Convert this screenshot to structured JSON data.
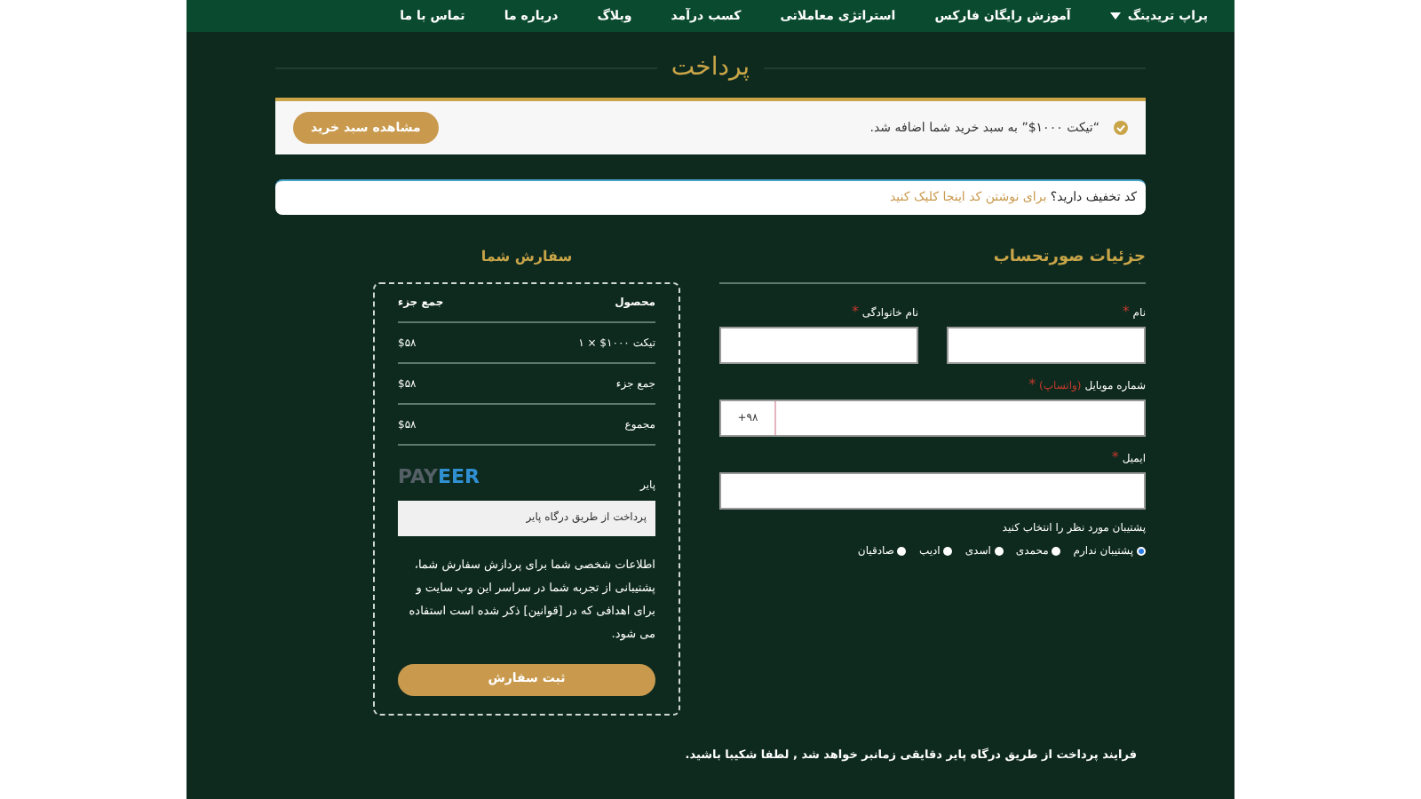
{
  "nav": [
    {
      "label": "پراپ تریدینگ",
      "dropdown": true
    },
    {
      "label": "آموزش رایگان فارکس",
      "dropdown": false
    },
    {
      "label": "استراتژی معاملاتی",
      "dropdown": false
    },
    {
      "label": "کسب درآمد",
      "dropdown": false
    },
    {
      "label": "وبلاگ",
      "dropdown": false
    },
    {
      "label": "درباره ما",
      "dropdown": false
    },
    {
      "label": "تماس با ما",
      "dropdown": false
    }
  ],
  "page_title": "پرداخت",
  "notice": {
    "message": "“تیکت ۱۰۰۰$” به سبد خرید شما اضافه شد.",
    "button": "مشاهده سبد خرید"
  },
  "coupon": {
    "question": "کد تخفیف دارید؟",
    "link": "برای نوشتن کد اینجا کلیک کنید"
  },
  "billing": {
    "title": "جزئیات صورتحساب",
    "fields": [
      {
        "label": "نام",
        "required_mark": "*"
      },
      {
        "label": "نام خانوادگی",
        "required_mark": "*"
      }
    ],
    "phone": {
      "label": "شماره موبایل",
      "note": "(واتساپ)",
      "required_mark": "*",
      "prefix": "+۹۸"
    },
    "email": {
      "label": "ایمیل",
      "required_mark": "*"
    },
    "support_prompt": "پشتیبان مورد نظر را انتخاب کنید",
    "supporters": [
      {
        "label": "پشتیبان ندارم",
        "selected": true
      },
      {
        "label": "محمدی",
        "selected": false
      },
      {
        "label": "اسدی",
        "selected": false
      },
      {
        "label": "ادیب",
        "selected": false
      },
      {
        "label": "صادقیان",
        "selected": false
      }
    ]
  },
  "order": {
    "title": "سفارش شما",
    "columns": [
      "محصول",
      "جمع جزء"
    ],
    "rows": [
      {
        "label": "تیکت ۱۰۰۰$ × ۱",
        "value": "$۵۸"
      },
      {
        "label": "جمع جزء",
        "value": "$۵۸"
      },
      {
        "label": "مجموع",
        "value": "$۵۸"
      }
    ],
    "payment": {
      "name": "پایر",
      "logo_left": "PAY",
      "logo_right": "EER",
      "description": "پرداخت از طریق درگاه پایر"
    },
    "privacy": "اطلاعات شخصی شما برای پردازش سفارش شما، پشتیبانی از تجربه شما در سراسر این وب سایت و برای اهدافی که در [قوانین] ذکر شده است استفاده می شود.",
    "submit": "ثبت سفارش"
  },
  "footer_note": "فرایند پرداخت از طریق درگاه پایر دقایقی زمانبر خواهد شد , لطفا شکیبا باشید."
}
